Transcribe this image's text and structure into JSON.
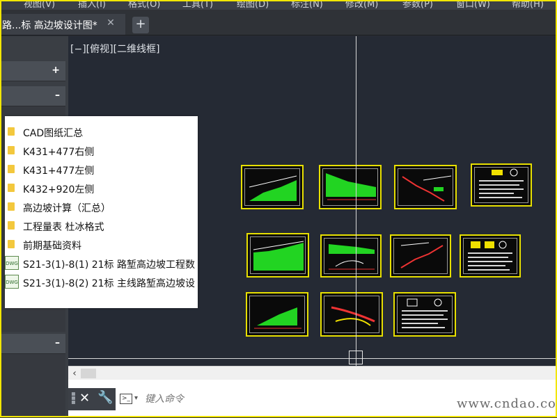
{
  "menu": [
    "视图(V)",
    "插入(I)",
    "格式(O)",
    "工具(T)",
    "绘图(D)",
    "标注(N)",
    "修改(M)",
    "参数(P)",
    "窗口(W)",
    "帮助(H)"
  ],
  "tab": {
    "label": "路...标  高边坡设计图*",
    "close": "✕",
    "add": "+"
  },
  "left_panel": {
    "expand_symbol": "+",
    "collapse_symbol": "–",
    "collapse_symbol_2": "–"
  },
  "viewport": {
    "label": "[−][俯视][二维线框]"
  },
  "popup": {
    "folders": [
      "CAD图纸汇总",
      "K431+477右侧",
      "K431+477左侧",
      "K432+920左侧",
      "高边坡计算（汇总）",
      "工程量表 杜冰格式",
      "前期基础资料"
    ],
    "files": [
      {
        "name": "S21-3(1)-8(1) 21标 路堑高边坡工程数",
        "icon": "DWG"
      },
      {
        "name": "S21-3(1)-8(2)  21标 主线路堑高边坡设",
        "icon": "DWG"
      }
    ]
  },
  "command": {
    "placeholder": "键入命令",
    "close": "✕",
    "wrench": "🔧",
    "prompt_icon": ">_",
    "caret": "▾"
  },
  "scrollbar": {
    "left_arrow": "‹"
  },
  "watermark": "www.cndao.com",
  "colors": {
    "sheet_border": "#e8e000",
    "drawing_bg": "#252a34",
    "fill_green": "#22d422"
  }
}
